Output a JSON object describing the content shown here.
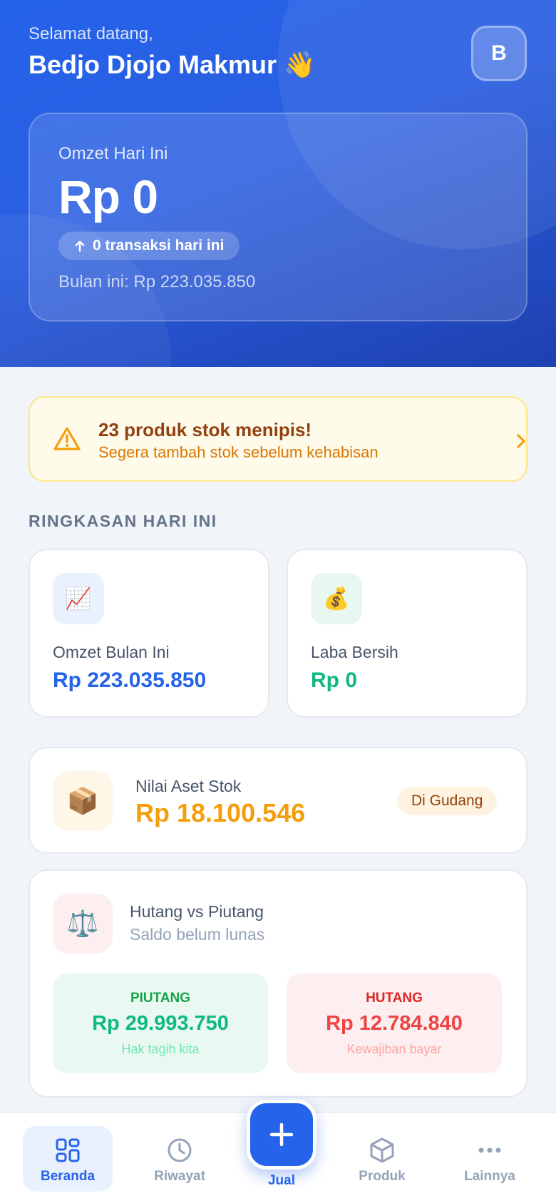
{
  "header": {
    "greeting": "Selamat datang,",
    "user_name": "Bedjo Djojo Makmur 👋",
    "avatar_initial": "B"
  },
  "sales_card": {
    "label": "Omzet Hari Ini",
    "value": "Rp 0",
    "transactions_text": "0 transaksi hari ini",
    "month_text": "Bulan ini: Rp 223.035.850"
  },
  "stock_alert": {
    "title": "23 produk stok menipis!",
    "subtitle": "Segera tambah stok sebelum kehabisan"
  },
  "summary": {
    "section_title": "RINGKASAN HARI INI",
    "monthly_revenue": {
      "icon": "📈",
      "label": "Omzet Bulan Ini",
      "value": "Rp 223.035.850"
    },
    "net_profit": {
      "icon": "💰",
      "label": "Laba Bersih",
      "value": "Rp 0"
    }
  },
  "stock_asset": {
    "icon": "📦",
    "label": "Nilai Aset Stok",
    "value": "Rp 18.100.546",
    "badge": "Di Gudang"
  },
  "debt": {
    "icon": "⚖️",
    "title": "Hutang vs Piutang",
    "subtitle": "Saldo belum lunas",
    "receivable": {
      "label": "PIUTANG",
      "value": "Rp 29.993.750",
      "hint": "Hak tagih kita"
    },
    "payable": {
      "label": "HUTANG",
      "value": "Rp 12.784.840",
      "hint": "Kewajiban bayar"
    }
  },
  "nav": {
    "home": "Beranda",
    "history": "Riwayat",
    "sell": "Jual",
    "products": "Produk",
    "more": "Lainnya"
  },
  "colors": {
    "primary": "#2563eb",
    "success": "#10b981",
    "danger": "#ef4444",
    "warning": "#f59e0b"
  }
}
